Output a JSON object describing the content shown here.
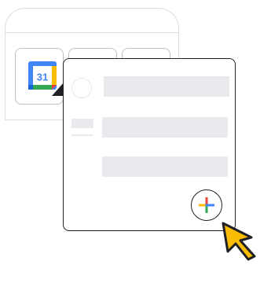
{
  "browser": {
    "tabs": [
      {
        "name": "calendar-tab",
        "icon": "google-calendar-icon"
      },
      {
        "name": "blank-tab"
      },
      {
        "name": "blank-tab"
      }
    ]
  },
  "calendar_icon": {
    "day": "31",
    "colors": {
      "blue": "#4285F4",
      "red": "#EA4335",
      "yellow": "#FBBC04",
      "green": "#34A853"
    }
  },
  "popup": {
    "add_button_icon": "plus-icon"
  },
  "cursor": {
    "icon": "cursor-arrow-icon",
    "color": "#FBBC04"
  }
}
